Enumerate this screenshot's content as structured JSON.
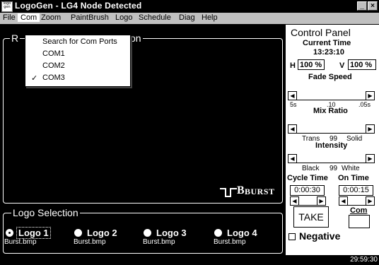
{
  "window": {
    "title": "LogoGen - LG4 Node Detected",
    "icon": "app-icon",
    "icon_text": "logo gen"
  },
  "menubar": {
    "file": "File",
    "com": "Com",
    "zoom": "Zoom",
    "paintbrush": "PaintBrush",
    "logo": "Logo",
    "schedule": "Schedule",
    "diag": "Diag",
    "help": "Help"
  },
  "com_menu": {
    "items": [
      "Search for Com Ports",
      "COM1",
      "COM2",
      "COM3"
    ],
    "checked_item": "COM3",
    "check_glyph": "✓"
  },
  "preview": {
    "title_left": "R",
    "title_right": "on",
    "logo_text": "BURST",
    "logo_initial": "B"
  },
  "logo_selection": {
    "title": "Logo Selection",
    "logos": [
      {
        "label": "Logo 1",
        "file": "Burst.bmp",
        "selected": true
      },
      {
        "label": "Logo 2",
        "file": "Burst.bmp",
        "selected": false
      },
      {
        "label": "Logo 3",
        "file": "Burst.bmp",
        "selected": false
      },
      {
        "label": "Logo 4",
        "file": "Burst.bmp",
        "selected": false
      }
    ]
  },
  "control_panel": {
    "title": "Control Panel",
    "current_time_label": "Current Time",
    "current_time": "13:23:10",
    "h_label": "H",
    "h_value": "100",
    "h_unit": "%",
    "v_label": "V",
    "v_value": "100",
    "v_unit": "%",
    "fade_speed": {
      "label": "Fade Speed",
      "ticks": [
        "5s",
        ".10",
        ".05s"
      ]
    },
    "mix_ratio": {
      "label": "Mix Ratio",
      "left": "Trans",
      "value": "99",
      "right": "Solid"
    },
    "intensity": {
      "label": "Intensity",
      "left": "Black",
      "value": "99",
      "right": "White"
    },
    "cycle_time_label": "Cycle Time",
    "on_time_label": "On Time",
    "cycle_time": "0:00:30",
    "on_time": "0:00:15",
    "take_button": "TAKE",
    "com_label": "Com",
    "negative_label": "Negative"
  },
  "status": {
    "clock": "29:59:30"
  },
  "colors": {
    "background": "#000000",
    "panel": "#ffffff",
    "menubar": "#c0c0c0"
  }
}
